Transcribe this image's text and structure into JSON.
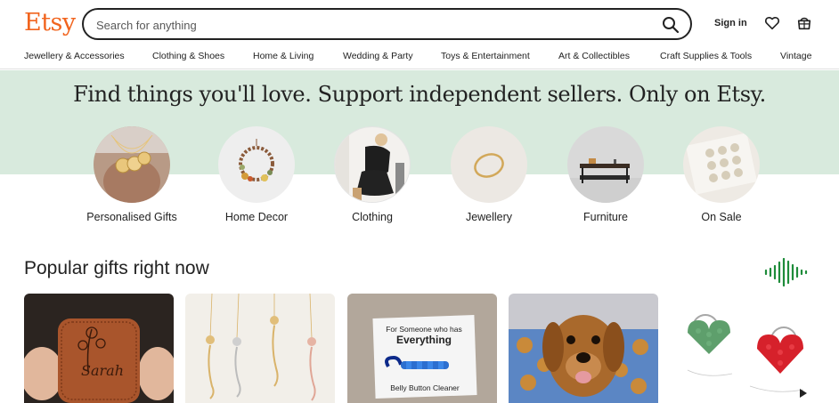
{
  "header": {
    "logo": "Etsy",
    "search_placeholder": "Search for anything",
    "sign_in": "Sign in"
  },
  "categories": [
    "Jewellery & Accessories",
    "Clothing & Shoes",
    "Home & Living",
    "Wedding & Party",
    "Toys & Entertainment",
    "Art & Collectibles",
    "Craft Supplies & Tools",
    "Vintage"
  ],
  "hero": {
    "title": "Find things you'll love. Support independent sellers. Only on Etsy."
  },
  "circles": [
    {
      "label": "Personalised Gifts"
    },
    {
      "label": "Home Decor"
    },
    {
      "label": "Clothing"
    },
    {
      "label": "Jewellery"
    },
    {
      "label": "Furniture"
    },
    {
      "label": "On Sale"
    }
  ],
  "popular": {
    "title": "Popular gifts right now",
    "cards": [
      {
        "text": "Sarah"
      },
      {
        "text": ""
      },
      {
        "line1": "For Someone who has",
        "line2": "Everything",
        "line3": "Belly Button Cleaner"
      },
      {
        "text": ""
      },
      {
        "text": ""
      }
    ]
  },
  "colors": {
    "brand": "#F1641E",
    "hero_bg": "#D8EADD",
    "sound_icon": "#1E8C3A"
  }
}
